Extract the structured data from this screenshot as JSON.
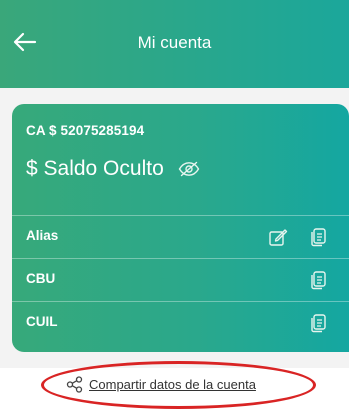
{
  "header": {
    "title": "Mi cuenta",
    "back_icon": "arrow-left-icon",
    "color_start": "#3aa77a",
    "color_end": "#1ba79b"
  },
  "account": {
    "number": "CA $ 52075285194",
    "balance_label": "$ Saldo Oculto",
    "visibility_icon": "eye-slash-icon"
  },
  "rows": [
    {
      "label": "Alias",
      "icons": [
        "edit-icon",
        "copy-icon"
      ]
    },
    {
      "label": "CBU",
      "icons": [
        "copy-icon"
      ]
    },
    {
      "label": "CUIL",
      "icons": [
        "copy-icon"
      ]
    }
  ],
  "share": {
    "label": "Compartir datos de la cuenta",
    "icon": "share-icon",
    "highlight_color": "#d92424"
  }
}
